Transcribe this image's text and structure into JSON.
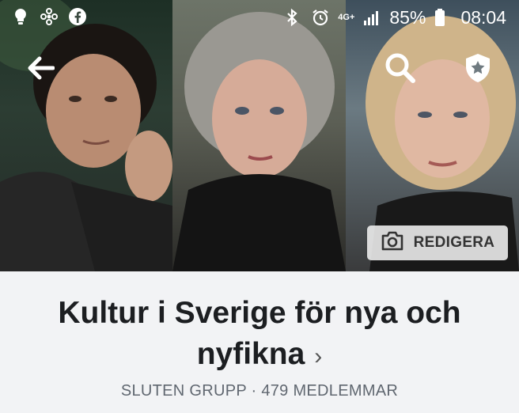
{
  "status_bar": {
    "left_icons": [
      "lightbulb-icon",
      "fan-icon",
      "facebook-icon"
    ],
    "right_icons": [
      "bluetooth-icon",
      "alarm-icon",
      "signal-icon",
      "battery-icon"
    ],
    "network": "4G+",
    "battery": "85%",
    "time": "08:04"
  },
  "header": {
    "back_icon": "arrow-left-icon",
    "search_icon": "search-icon",
    "shield_icon": "shield-star-icon"
  },
  "cover": {
    "edit_label": "REDIGERA",
    "edit_icon": "camera-icon"
  },
  "group": {
    "name_line1": "Kultur i Sverige för nya och",
    "name_line2": "nyfikna",
    "chevron": "›",
    "type": "SLUTEN GRUPP",
    "separator": "·",
    "members": "479 MEDLEMMAR"
  }
}
